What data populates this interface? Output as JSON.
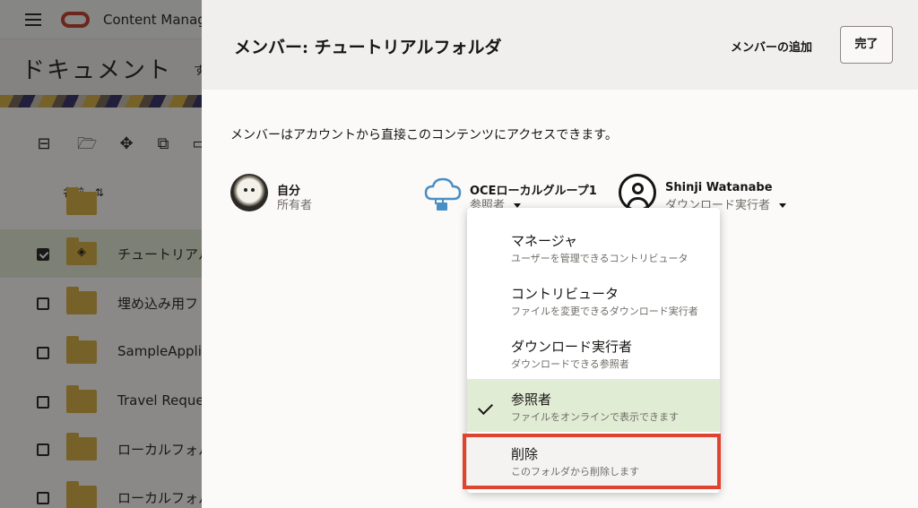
{
  "app": {
    "title": "Content Manage"
  },
  "page": {
    "title": "ドキュメント",
    "sub": "す"
  },
  "file_list": {
    "column_name": "名前",
    "rows": [
      {
        "label": "",
        "checked": false
      },
      {
        "label": "チュートリアルフ",
        "checked": true,
        "icon": "layers-icon"
      },
      {
        "label": "埋め込み用フ",
        "checked": false
      },
      {
        "label": "SampleApplic",
        "checked": false
      },
      {
        "label": "Travel Reques",
        "checked": false
      },
      {
        "label": "ローカルフォル",
        "checked": false
      },
      {
        "label": "ローカルフォル",
        "checked": false
      }
    ]
  },
  "panel": {
    "title": "メンバー: チュートリアルフォルダ",
    "add_member_label": "メンバーの追加",
    "done_label": "完了",
    "intro": "メンバーはアカウントから直接このコンテンツにアクセスできます。"
  },
  "members": [
    {
      "name": "自分",
      "role": "所有者",
      "avatar": "dog-photo"
    },
    {
      "name": "OCEローカルグループ1",
      "role": "参照者",
      "avatar": "cloud-group-icon"
    },
    {
      "name": "Shinji Watanabe",
      "role": "ダウンロード実行者",
      "avatar": "user-icon"
    }
  ],
  "role_menu": {
    "items": [
      {
        "title": "マネージャ",
        "description": "ユーザーを管理できるコントリビュータ",
        "selected": false
      },
      {
        "title": "コントリビュータ",
        "description": "ファイルを変更できるダウンロード実行者",
        "selected": false
      },
      {
        "title": "ダウンロード実行者",
        "description": "ダウンロードできる参照者",
        "selected": false
      },
      {
        "title": "参照者",
        "description": "ファイルをオンラインで表示できます",
        "selected": true
      },
      {
        "title": "削除",
        "description": "このフォルダから削除します",
        "selected": false,
        "highlighted": true
      }
    ]
  },
  "colors": {
    "accent_highlight": "#e0442e",
    "selected_bg": "#e1ecd4",
    "folder": "#d8b24a",
    "oracle_red": "#c74634"
  }
}
